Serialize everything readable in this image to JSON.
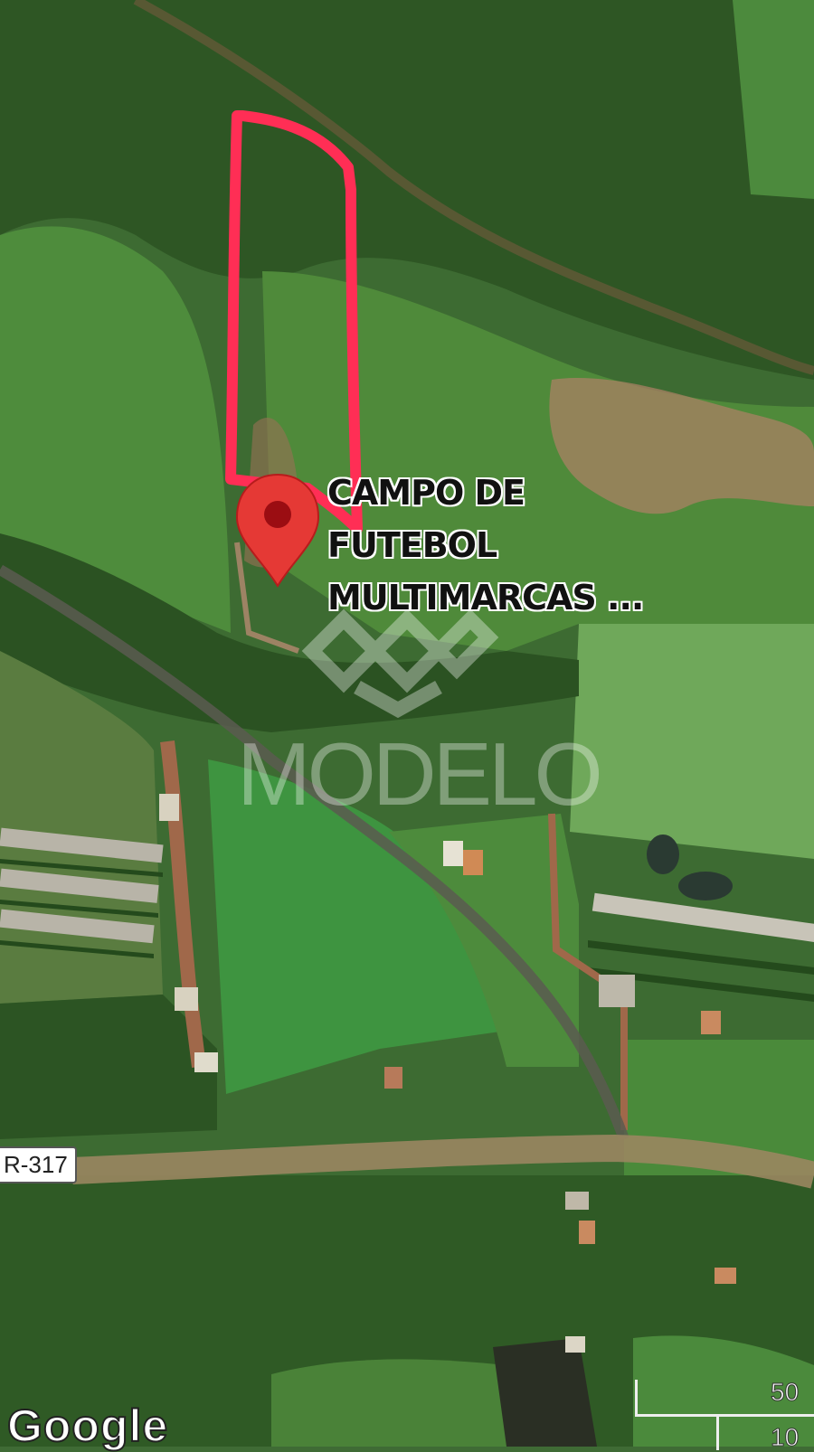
{
  "map": {
    "type": "satellite",
    "colors": {
      "forest": "#2f5a26",
      "field": "#4f8a3c",
      "field_light": "#6fa55a",
      "soil": "#9a6a4f",
      "road": "#8a7a55",
      "highlight_stroke": "#ff2e4f",
      "pin": "#e53935"
    }
  },
  "pin": {
    "icon": "map-pin-icon",
    "label": "CAMPO DE\nFUTEBOL\nMULTIMARCAS ..."
  },
  "road_shield": {
    "label": "R-317"
  },
  "watermark": {
    "text": "MODELO",
    "icon": "modelo-logo-icon"
  },
  "attribution": {
    "label": "Google"
  },
  "scale_bar": {
    "top_label": "50",
    "bottom_label": "10"
  }
}
